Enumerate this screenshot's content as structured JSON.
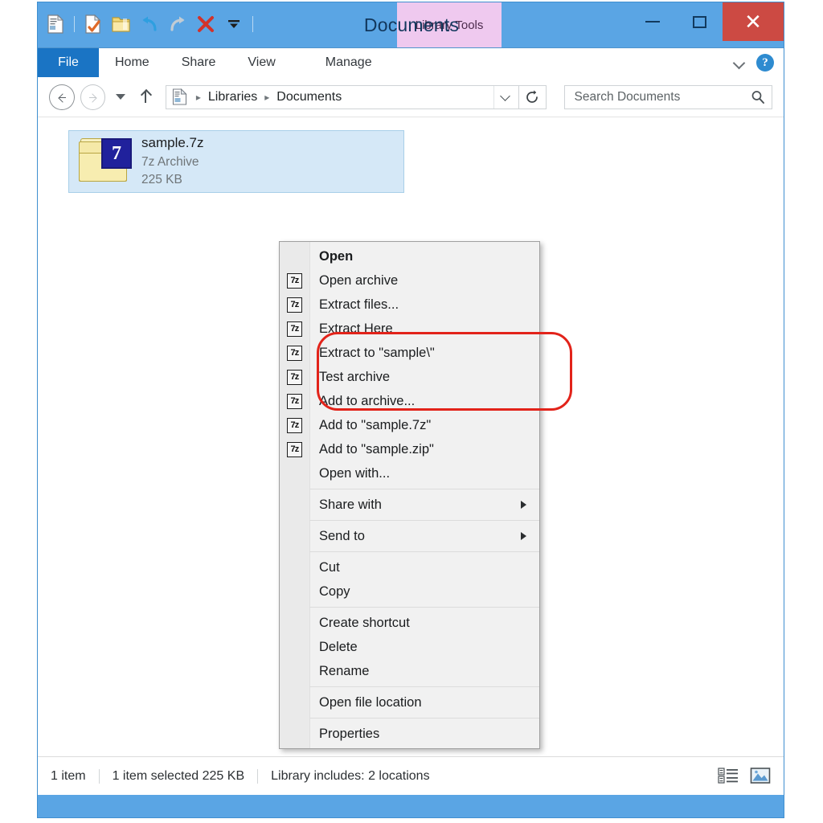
{
  "window": {
    "title": "Documents",
    "contextual_tab_group": "Library Tools",
    "controls": {
      "minimize": "Minimize",
      "maximize": "Maximize",
      "close": "Close"
    },
    "quick_access": [
      {
        "name": "properties-icon",
        "label": "Properties"
      },
      {
        "name": "new-folder-icon",
        "label": "New folder"
      },
      {
        "name": "undo-icon",
        "label": "Undo"
      },
      {
        "name": "redo-icon",
        "label": "Redo"
      },
      {
        "name": "delete-icon",
        "label": "Delete"
      },
      {
        "name": "customize-qat-icon",
        "label": "Customize Quick Access Toolbar"
      }
    ]
  },
  "ribbon": {
    "tabs": [
      {
        "label": "File",
        "active": true
      },
      {
        "label": "Home",
        "active": false
      },
      {
        "label": "Share",
        "active": false
      },
      {
        "label": "View",
        "active": false
      },
      {
        "label": "Manage",
        "active": false
      }
    ],
    "expand_label": "Expand the Ribbon",
    "help_label": "?"
  },
  "address": {
    "back": "Back",
    "forward": "Forward",
    "recent": "Recent locations",
    "up": "Up",
    "breadcrumbs": [
      "Libraries",
      "Documents"
    ],
    "separator": "▸",
    "dropdown": "Previous locations",
    "refresh": "Refresh"
  },
  "search": {
    "placeholder": "Search Documents",
    "icon": "search-icon"
  },
  "file_item": {
    "name": "sample.7z",
    "type": "7z Archive",
    "size": "225 KB",
    "icon": "7z-archive-folder-icon",
    "badge": "7",
    "selected": true
  },
  "context_menu": {
    "groups": [
      {
        "items": [
          {
            "label": "Open",
            "icon": null,
            "bold": true,
            "submenu": false
          },
          {
            "label": "Open archive",
            "icon": "7z-icon",
            "bold": false,
            "submenu": false
          },
          {
            "label": "Extract files...",
            "icon": "7z-icon",
            "bold": false,
            "submenu": false
          },
          {
            "label": "Extract Here",
            "icon": "7z-icon",
            "bold": false,
            "submenu": false
          },
          {
            "label": "Extract to \"sample\\\"",
            "icon": "7z-icon",
            "bold": false,
            "submenu": false
          },
          {
            "label": "Test archive",
            "icon": "7z-icon",
            "bold": false,
            "submenu": false
          },
          {
            "label": "Add to archive...",
            "icon": "7z-icon",
            "bold": false,
            "submenu": false
          },
          {
            "label": "Add to \"sample.7z\"",
            "icon": "7z-icon",
            "bold": false,
            "submenu": false
          },
          {
            "label": "Add to \"sample.zip\"",
            "icon": "7z-icon",
            "bold": false,
            "submenu": false
          },
          {
            "label": "Open with...",
            "icon": null,
            "bold": false,
            "submenu": false
          }
        ]
      },
      {
        "items": [
          {
            "label": "Share with",
            "icon": null,
            "bold": false,
            "submenu": true
          }
        ]
      },
      {
        "items": [
          {
            "label": "Send to",
            "icon": null,
            "bold": false,
            "submenu": true
          }
        ]
      },
      {
        "items": [
          {
            "label": "Cut",
            "icon": null,
            "bold": false,
            "submenu": false
          },
          {
            "label": "Copy",
            "icon": null,
            "bold": false,
            "submenu": false
          }
        ]
      },
      {
        "items": [
          {
            "label": "Create shortcut",
            "icon": null,
            "bold": false,
            "submenu": false
          },
          {
            "label": "Delete",
            "icon": null,
            "bold": false,
            "submenu": false
          },
          {
            "label": "Rename",
            "icon": null,
            "bold": false,
            "submenu": false
          }
        ]
      },
      {
        "items": [
          {
            "label": "Open file location",
            "icon": null,
            "bold": false,
            "submenu": false
          }
        ]
      },
      {
        "items": [
          {
            "label": "Properties",
            "icon": null,
            "bold": false,
            "submenu": false
          }
        ]
      }
    ]
  },
  "annotation": {
    "shape": "rounded-rectangle",
    "color": "#e2231a",
    "highlights": [
      "Extract files...",
      "Extract Here",
      "Extract to \"sample\\\""
    ]
  },
  "status_bar": {
    "item_count": "1 item",
    "selection": "1 item selected  225 KB",
    "library_info": "Library includes: 2 locations",
    "views": [
      {
        "name": "details-view-button",
        "label": "Details view"
      },
      {
        "name": "large-icons-view-button",
        "label": "Large icons view",
        "active": true
      }
    ]
  },
  "colors": {
    "title_bar": "#5aa5e4",
    "file_tab": "#1a74c4",
    "contextual_tab": "#efc9ef",
    "close_button": "#cc4a43",
    "selection": "#d5e8f7",
    "annotation": "#e2231a",
    "menu_bg": "#f1f1f1"
  }
}
